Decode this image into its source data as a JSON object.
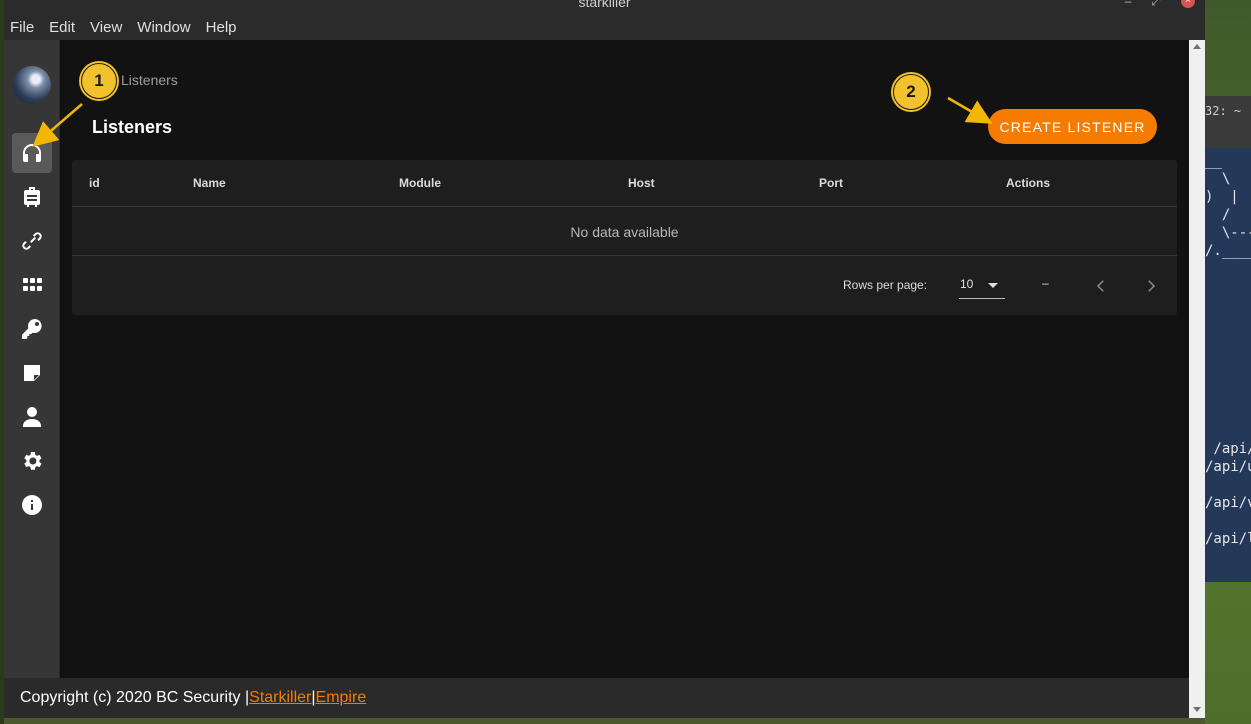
{
  "window": {
    "title": "starkiller"
  },
  "menu": [
    "File",
    "Edit",
    "View",
    "Window",
    "Help"
  ],
  "breadcrumb": "Listeners",
  "page_title": "Listeners",
  "create_button": "CREATE LISTENER",
  "table": {
    "columns": [
      "id",
      "Name",
      "Module",
      "Host",
      "Port",
      "Actions"
    ],
    "empty_text": "No data available",
    "rows_per_page_label": "Rows per page:",
    "rows_per_page_value": "10",
    "range_text": "–"
  },
  "footer": {
    "copyright": "Copyright (c) 2020 BC Security |",
    "separator": "|",
    "link1": "Starkiller",
    "link2": "Empire"
  },
  "sidebar_icons": [
    "headphones-icon",
    "briefcase-icon",
    "link-icon",
    "grid-icon",
    "key-icon",
    "note-icon",
    "user-icon",
    "gear-icon",
    "info-icon"
  ],
  "annotations": {
    "badge1": "1",
    "badge2": "2"
  },
  "terminal": {
    "title": "32: ~",
    "lines": [
      "__",
      "  \\",
      ")  |",
      "  /",
      "  \\---",
      "/.____",
      "",
      "",
      "",
      "",
      "",
      "",
      "",
      "",
      "",
      "",
      " /api/",
      "/api/u",
      "",
      "/api/v",
      "",
      "/api/l"
    ]
  },
  "colors": {
    "accent": "#f57c00",
    "badge": "#f2c12e",
    "sidebar": "#363636",
    "background": "#121212"
  }
}
